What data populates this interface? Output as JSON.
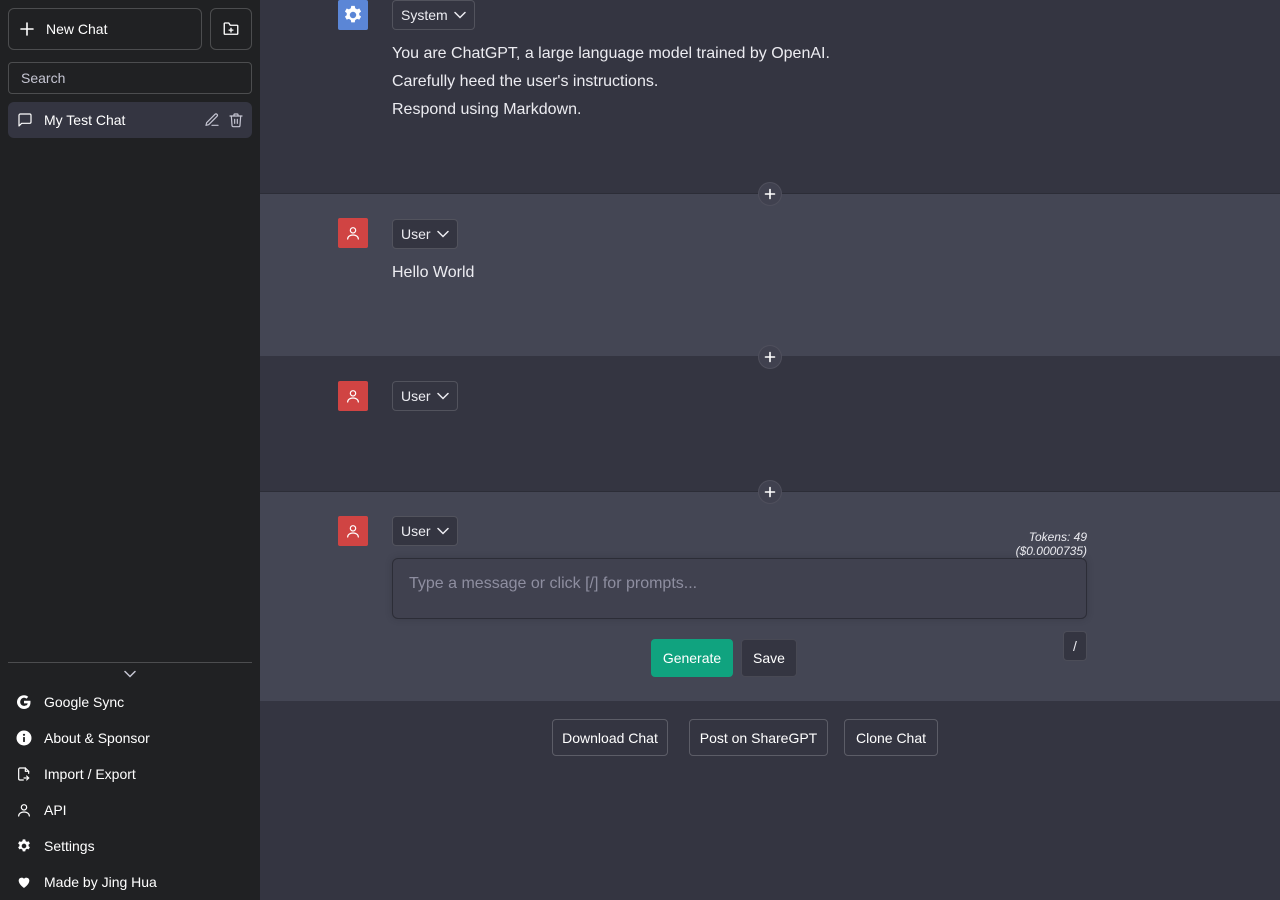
{
  "sidebar": {
    "new_chat_label": "New Chat",
    "search_placeholder": "Search",
    "chats": [
      {
        "title": "My Test Chat"
      }
    ],
    "menu": [
      {
        "label": "Google Sync",
        "icon": "google-icon"
      },
      {
        "label": "About & Sponsor",
        "icon": "info-icon"
      },
      {
        "label": "Import / Export",
        "icon": "import-export-icon"
      },
      {
        "label": "API",
        "icon": "person-icon"
      },
      {
        "label": "Settings",
        "icon": "gear-icon"
      },
      {
        "label": "Made by Jing Hua",
        "icon": "heart-icon"
      }
    ]
  },
  "messages": [
    {
      "role": "System",
      "lines": [
        "You are ChatGPT, a large language model trained by OpenAI.",
        "Carefully heed the user's instructions.",
        "Respond using Markdown."
      ]
    },
    {
      "role": "User",
      "lines": [
        "Hello World"
      ]
    },
    {
      "role": "User",
      "lines": []
    }
  ],
  "composer": {
    "role": "User",
    "tokens": "Tokens: 49 ($0.0000735)",
    "placeholder": "Type a message or click [/] for prompts...",
    "slash_label": "/",
    "generate_label": "Generate",
    "save_label": "Save"
  },
  "footer": {
    "download_label": "Download Chat",
    "share_label": "Post on ShareGPT",
    "clone_label": "Clone Chat"
  },
  "colors": {
    "accent": "#10a37f",
    "system_avatar": "#5b86d6",
    "user_avatar": "#d04443"
  }
}
